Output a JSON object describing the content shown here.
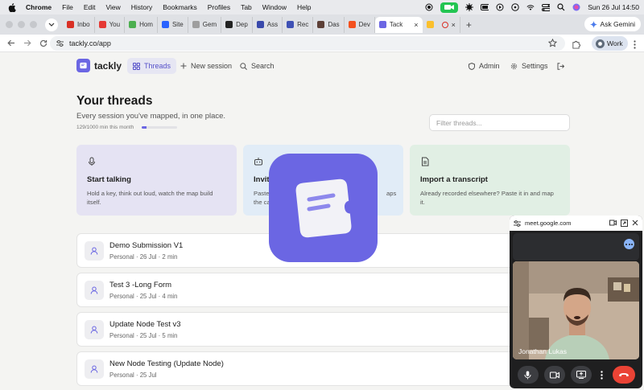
{
  "menubar": {
    "items": [
      "Chrome",
      "File",
      "Edit",
      "View",
      "History",
      "Bookmarks",
      "Profiles",
      "Tab",
      "Window",
      "Help"
    ],
    "clock": "Sun 26 Jul  14:50"
  },
  "tabs": [
    {
      "label": "Inbo",
      "color": "#d93025"
    },
    {
      "label": "You",
      "color": "#e53935"
    },
    {
      "label": "Hom",
      "color": "#4caf50"
    },
    {
      "label": "Site",
      "color": "#2962ff"
    },
    {
      "label": "Gem",
      "color": "#9e9e9e"
    },
    {
      "label": "Dep",
      "color": "#222222"
    },
    {
      "label": "Ass",
      "color": "#3949ab"
    },
    {
      "label": "Rec",
      "color": "#3f51b5"
    },
    {
      "label": "Das",
      "color": "#5d4037"
    },
    {
      "label": "Dev",
      "color": "#f4511e"
    },
    {
      "label": "Tack",
      "color": "#6b66e3",
      "active": true
    },
    {
      "label": "",
      "color": "#fbc02d"
    }
  ],
  "browser": {
    "gemini_label": "Ask Gemini",
    "url": "tackly.co/app",
    "profile_label": "Work"
  },
  "app": {
    "logo_text": "tackly",
    "nav": {
      "threads": "Threads",
      "new_session": "New session",
      "search": "Search",
      "admin": "Admin",
      "settings": "Settings"
    },
    "title": "Your threads",
    "subtitle": "Every session you've mapped, in one place.",
    "usage_text": "129/1000 min this month",
    "usage_fraction": 0.129,
    "filter_placeholder": "Filter threads...",
    "cards": [
      {
        "title": "Start talking",
        "desc": "Hold a key, think out loud, watch the map build itself.",
        "bg": "#e5e3f3"
      },
      {
        "title": "Invit",
        "desc": "Paste … maps the ca…",
        "bg": "#e1ecf7"
      },
      {
        "title": "Import a transcript",
        "desc": "Already recorded elsewhere? Paste it in and map it.",
        "bg": "#e1efe4"
      }
    ],
    "card2": {
      "title_start": "Invit",
      "desc_left1": "Paste",
      "desc_left2": "the ca",
      "desc_right": "aps"
    },
    "threads": [
      {
        "title": "Demo Submission V1",
        "meta": "Personal · 26 Jul · 2 min"
      },
      {
        "title": "Test 3 -Long Form",
        "meta": "Personal · 25 Jul · 4 min"
      },
      {
        "title": "Update Node Test v3",
        "meta": "Personal · 25 Jul · 5 min"
      },
      {
        "title": "New Node Testing (Update Node)",
        "meta": "Personal · 25 Jul"
      }
    ]
  },
  "meet": {
    "url": "meet.google.com",
    "participant": "Jonathan Lukas"
  }
}
